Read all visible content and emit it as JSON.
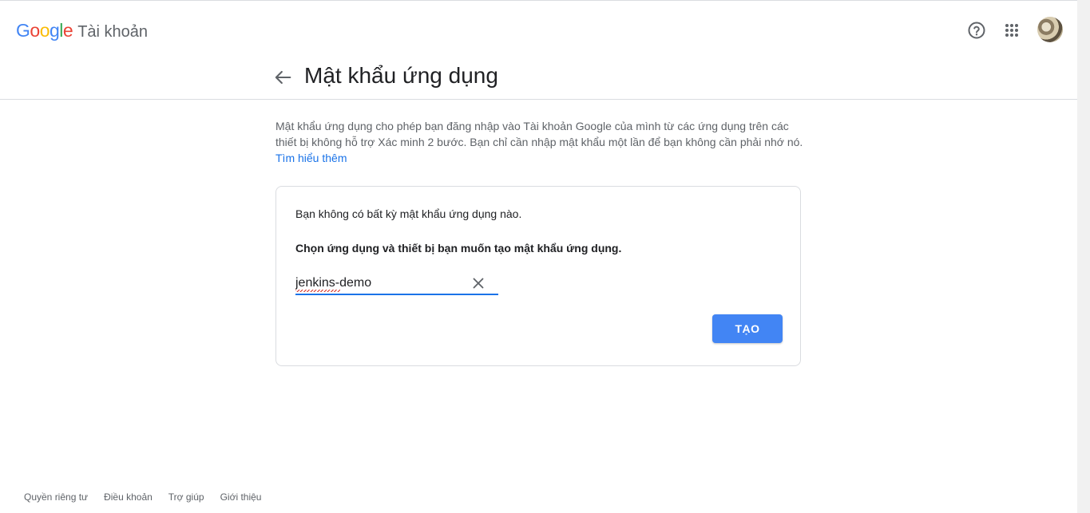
{
  "header": {
    "logo_letters": [
      {
        "ch": "G",
        "color": "#4285f4"
      },
      {
        "ch": "o",
        "color": "#ea4335"
      },
      {
        "ch": "o",
        "color": "#fbbc05"
      },
      {
        "ch": "g",
        "color": "#4285f4"
      },
      {
        "ch": "l",
        "color": "#34a853"
      },
      {
        "ch": "e",
        "color": "#ea4335"
      }
    ],
    "product": "Tài khoản",
    "icons": [
      "help-icon",
      "apps-icon",
      "avatar"
    ]
  },
  "page": {
    "title": "Mật khẩu ứng dụng",
    "description": "Mật khẩu ứng dụng cho phép bạn đăng nhập vào Tài khoản Google của mình từ các ứng dụng trên các thiết bị không hỗ trợ Xác minh 2 bước. Bạn chỉ cần nhập mật khẩu một lần để bạn không cần phải nhớ nó.",
    "learn_more": "Tìm hiểu thêm"
  },
  "card": {
    "empty_message": "Bạn không có bất kỳ mật khẩu ứng dụng nào.",
    "choose_message": "Chọn ứng dụng và thiết bị bạn muốn tạo mật khẩu ứng dụng.",
    "app_name_value": "jenkins-demo",
    "create_label": "TẠO"
  },
  "footer": {
    "links": [
      "Quyền riêng tư",
      "Điều khoản",
      "Trợ giúp",
      "Giới thiệu"
    ]
  },
  "colors": {
    "accent": "#1a73e8",
    "button": "#4285f4",
    "muted_text": "#5f6368",
    "border": "#dadce0"
  }
}
